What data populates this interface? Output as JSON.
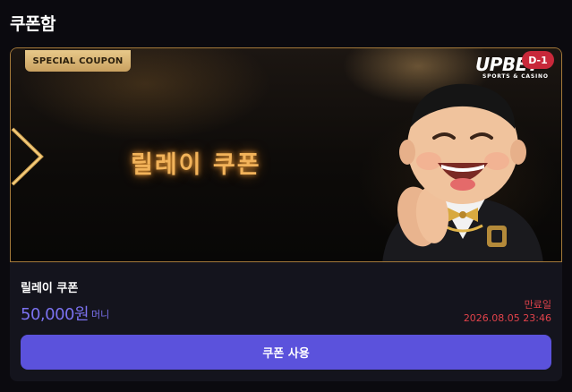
{
  "page": {
    "title": "쿠폰함"
  },
  "coupon": {
    "badge": "SPECIAL COUPON",
    "banner_title": "릴레이 쿠폰",
    "brand": {
      "logo": "UPBET",
      "sub": "SPORTS & CASINO"
    },
    "dday": "D-1",
    "name": "릴레이 쿠폰",
    "amount": "50,000원",
    "unit": "머니",
    "expiry_label": "만료일",
    "expiry_value": "2026.08.05 23:46",
    "use_button": "쿠폰 사용"
  },
  "colors": {
    "accent": "#5b52dc",
    "amount": "#7b72f0",
    "expiry": "#e0424a",
    "gold": "#c9a160",
    "dday_badge": "#c8283a"
  },
  "icons": {
    "banner_chevron": "chevron-right-icon",
    "mascot": "mascot-illustration"
  }
}
